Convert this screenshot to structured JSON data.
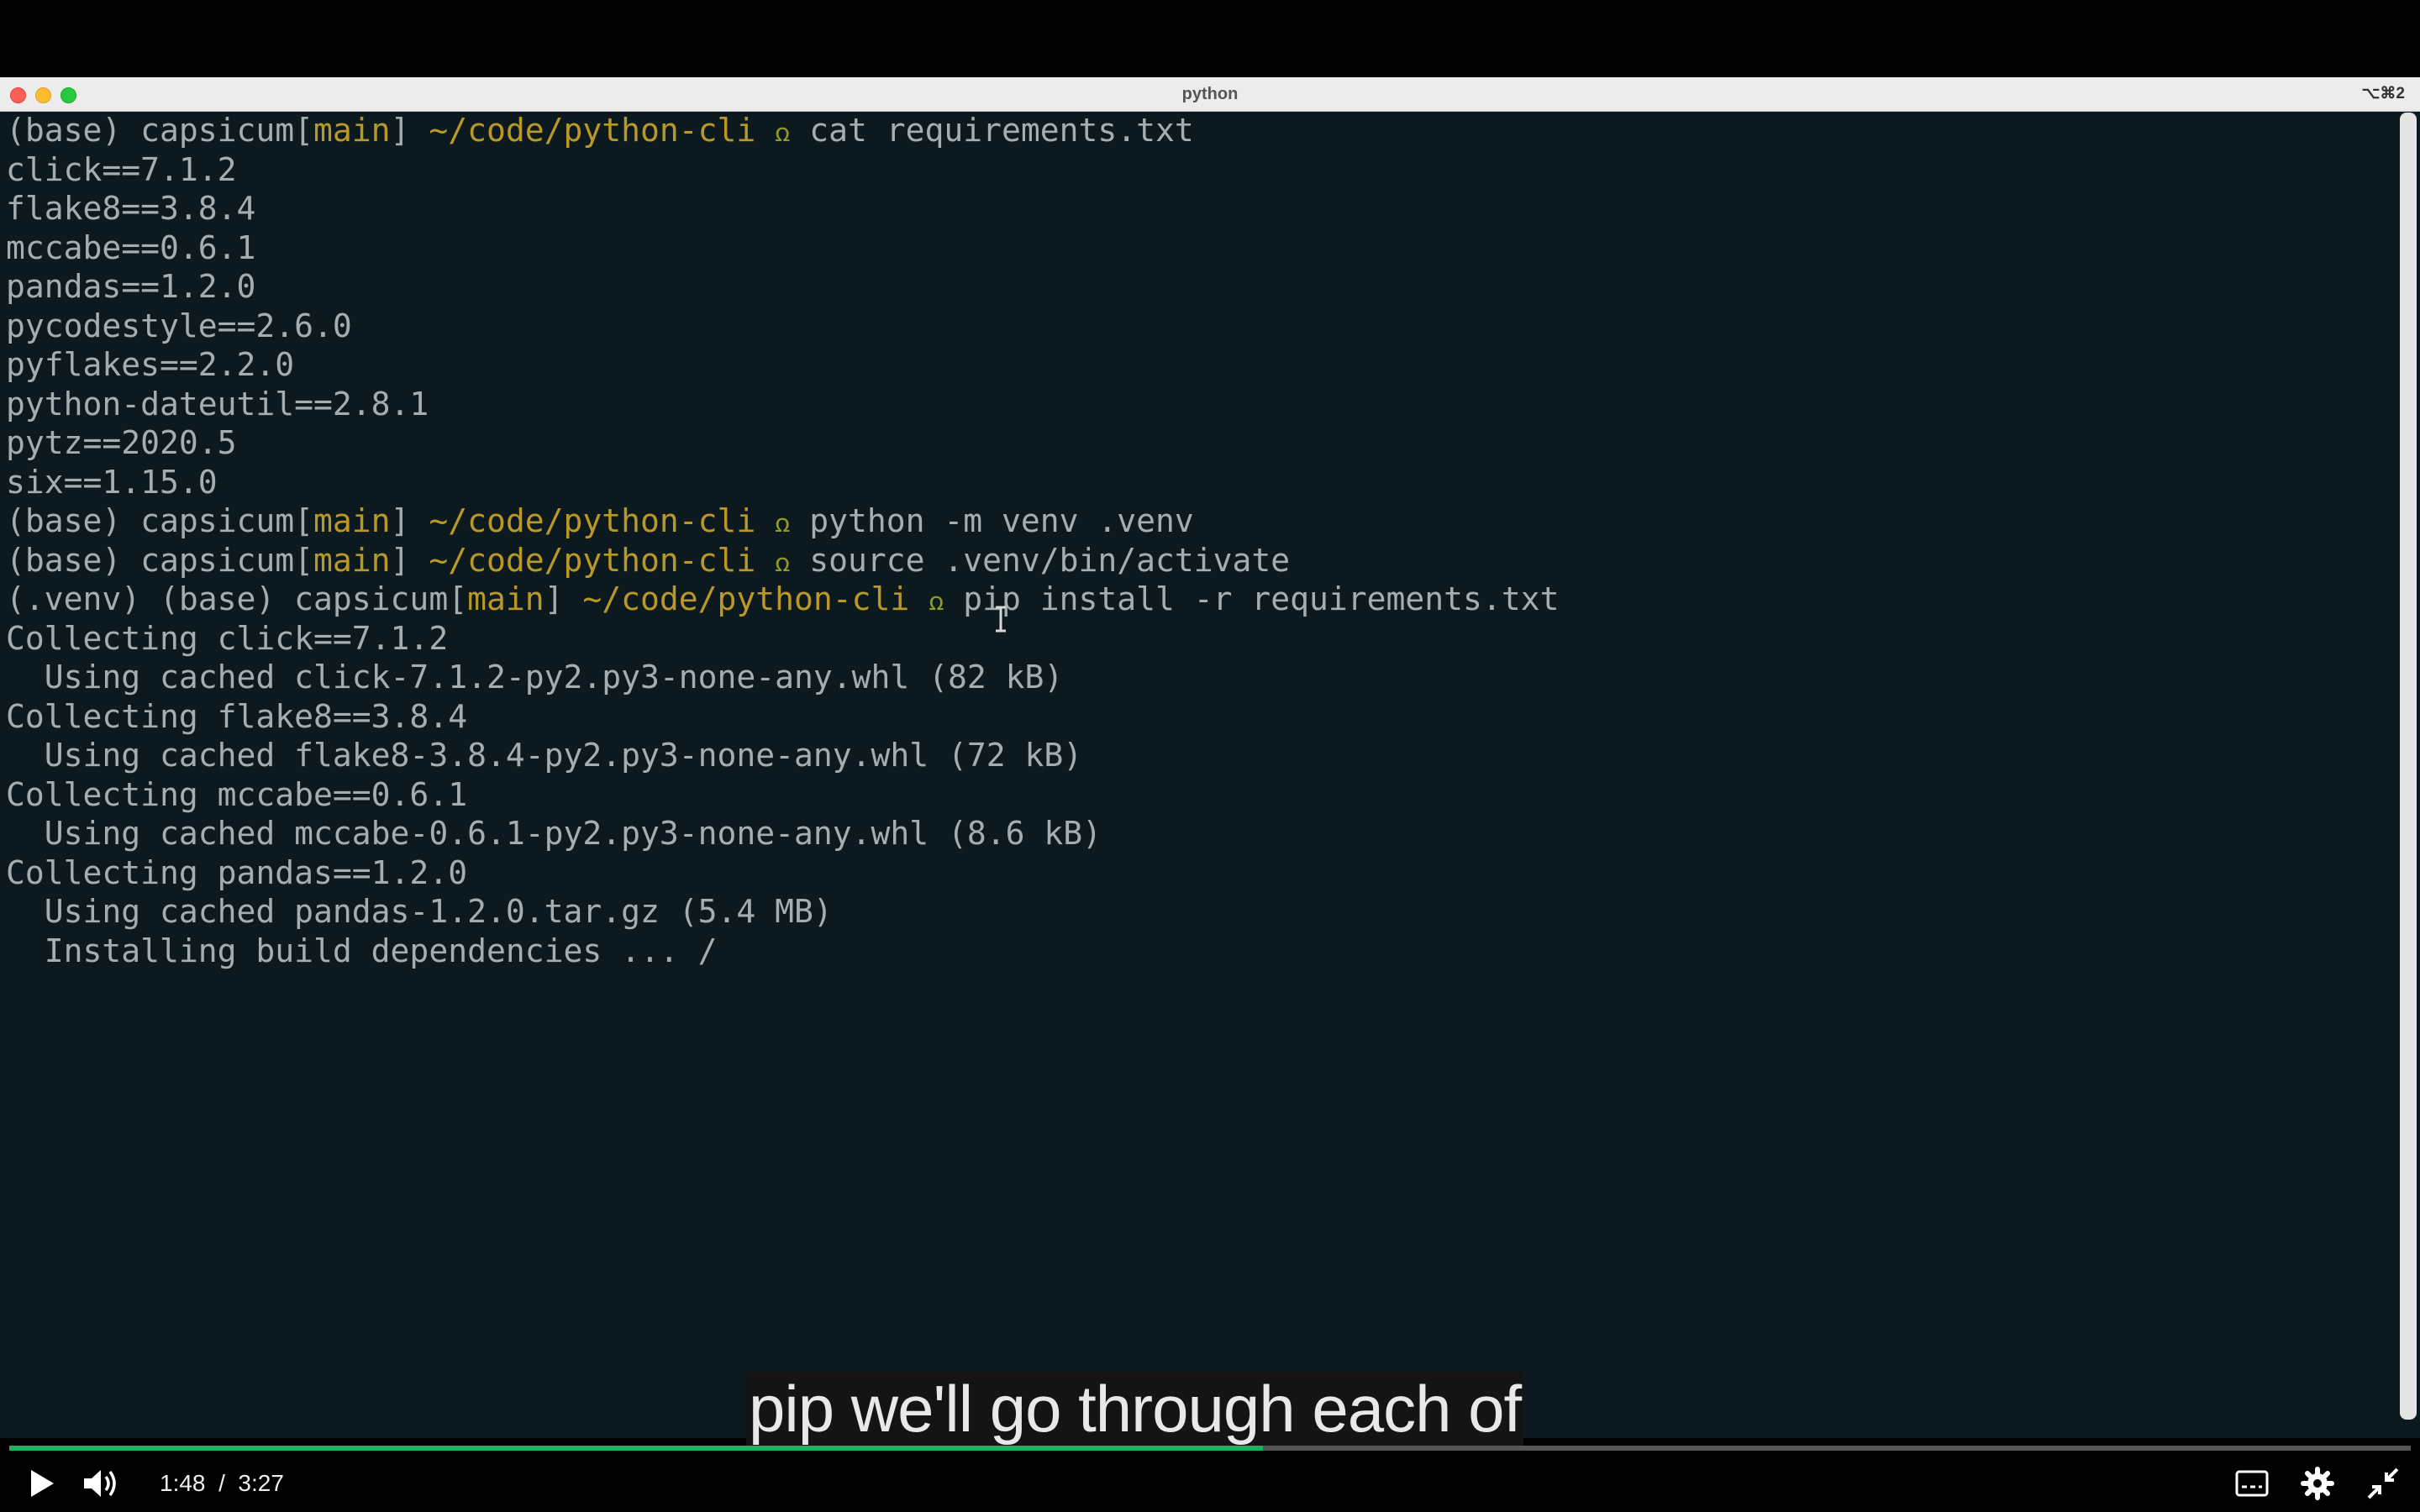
{
  "window": {
    "title": "python",
    "shortcut": "⌥⌘2"
  },
  "terminal": {
    "line1": {
      "prefix": "(base) capsicum[",
      "branch": "main",
      "mid": "] ",
      "path": "~/code/python-cli",
      "glyph": "ꭥ",
      "cmd": "cat requirements.txt"
    },
    "req": [
      "click==7.1.2",
      "flake8==3.8.4",
      "mccabe==0.6.1",
      "pandas==1.2.0",
      "pycodestyle==2.6.0",
      "pyflakes==2.2.0",
      "python-dateutil==2.8.1",
      "pytz==2020.5",
      "six==1.15.0"
    ],
    "line2": {
      "prefix": "(base) capsicum[",
      "branch": "main",
      "mid": "] ",
      "path": "~/code/python-cli",
      "glyph": "ꭥ",
      "cmd": "python -m venv .venv"
    },
    "line3": {
      "prefix": "(base) capsicum[",
      "branch": "main",
      "mid": "] ",
      "path": "~/code/python-cli",
      "glyph": "ꭥ",
      "cmd": "source .venv/bin/activate"
    },
    "line4": {
      "prefix": "(.venv) (base) capsicum[",
      "branch": "main",
      "mid": "] ",
      "path": "~/code/python-cli",
      "glyph": "ꭥ",
      "cmd": "pip install -r requirements.txt"
    },
    "output": [
      "Collecting click==7.1.2",
      "  Using cached click-7.1.2-py2.py3-none-any.whl (82 kB)",
      "Collecting flake8==3.8.4",
      "  Using cached flake8-3.8.4-py2.py3-none-any.whl (72 kB)",
      "Collecting mccabe==0.6.1",
      "  Using cached mccabe-0.6.1-py2.py3-none-any.whl (8.6 kB)",
      "Collecting pandas==1.2.0",
      "  Using cached pandas-1.2.0.tar.gz (5.4 MB)",
      "  Installing build dependencies ... /"
    ]
  },
  "player": {
    "caption": "pip we'll go through each of",
    "time_current": "1:48",
    "time_separator": "/",
    "time_total": "3:27",
    "progress": 0.522,
    "accent": "#1db15f",
    "icons": [
      "play-icon",
      "volume-icon",
      "subtitles-icon",
      "settings-icon",
      "exit-fullscreen-icon"
    ]
  }
}
